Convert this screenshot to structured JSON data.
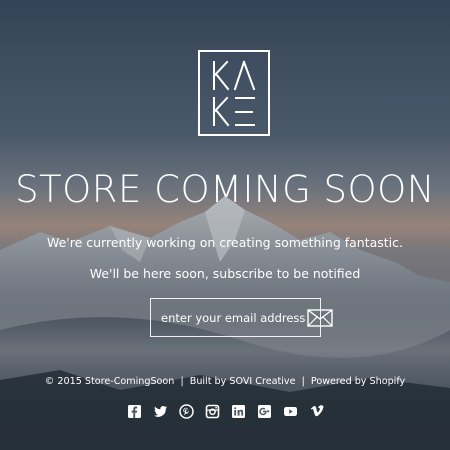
{
  "brand": {
    "logo_text": "KAKE"
  },
  "headline": "STORE COMING SOON",
  "tagline": "We're currently working on creating something fantastic.",
  "notify": "We'll be here soon, subscribe to be notified",
  "subscribe": {
    "placeholder": "enter your email address",
    "button_icon": "envelope-icon"
  },
  "footer": {
    "copyright": "© 2015 Store-ComingSoon",
    "sep1": "|",
    "built_by_label": "Built by",
    "built_by_link": "SOVI Creative",
    "sep2": "|",
    "powered_by": "Powered by Shopify"
  },
  "social": [
    {
      "name": "facebook-icon"
    },
    {
      "name": "twitter-icon"
    },
    {
      "name": "pinterest-icon"
    },
    {
      "name": "instagram-icon"
    },
    {
      "name": "linkedin-icon"
    },
    {
      "name": "google-plus-icon"
    },
    {
      "name": "youtube-icon"
    },
    {
      "name": "vimeo-icon"
    }
  ],
  "colors": {
    "text": "#ffffff",
    "sky_top": "#3d4f63",
    "sky_glow": "#c9a792",
    "mountain": "#4a5866"
  }
}
